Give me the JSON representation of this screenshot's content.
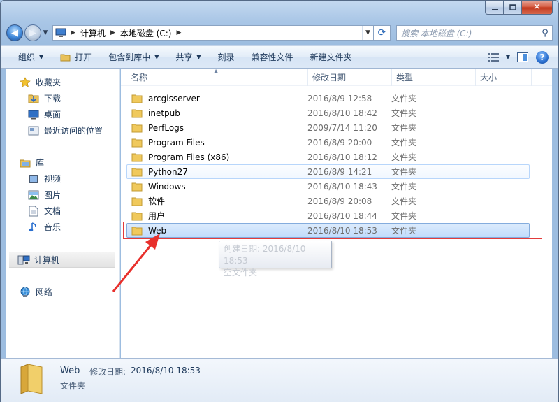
{
  "address": {
    "crumbs": [
      "计算机",
      "本地磁盘 (C:)"
    ]
  },
  "search": {
    "placeholder": "搜索 本地磁盘 (C:)"
  },
  "toolbar": {
    "organize": "组织",
    "open": "打开",
    "include_in_library": "包含到库中",
    "share": "共享",
    "burn": "刻录",
    "compatibility_files": "兼容性文件",
    "new_folder": "新建文件夹"
  },
  "nav": {
    "favorites": {
      "label": "收藏夹",
      "items": [
        "下载",
        "桌面",
        "最近访问的位置"
      ]
    },
    "libraries": {
      "label": "库",
      "items": [
        "视频",
        "图片",
        "文档",
        "音乐"
      ]
    },
    "computer": "计算机",
    "network": "网络"
  },
  "columns": [
    "名称",
    "修改日期",
    "类型",
    "大小"
  ],
  "files": [
    {
      "name": "arcgisserver",
      "date": "2016/8/9 12:58",
      "type": "文件夹"
    },
    {
      "name": "inetpub",
      "date": "2016/8/10 18:42",
      "type": "文件夹"
    },
    {
      "name": "PerfLogs",
      "date": "2009/7/14 11:20",
      "type": "文件夹"
    },
    {
      "name": "Program Files",
      "date": "2016/8/9 20:00",
      "type": "文件夹"
    },
    {
      "name": "Program Files (x86)",
      "date": "2016/8/10 18:12",
      "type": "文件夹"
    },
    {
      "name": "Python27",
      "date": "2016/8/9 14:21",
      "type": "文件夹"
    },
    {
      "name": "Windows",
      "date": "2016/8/10 18:43",
      "type": "文件夹"
    },
    {
      "name": "软件",
      "date": "2016/8/9 20:08",
      "type": "文件夹"
    },
    {
      "name": "用户",
      "date": "2016/8/10 18:44",
      "type": "文件夹"
    },
    {
      "name": "Web",
      "date": "2016/8/10 18:53",
      "type": "文件夹"
    }
  ],
  "tooltip": {
    "line1": "创建日期: 2016/8/10 18:53",
    "line2": "空文件夹"
  },
  "details": {
    "name": "Web",
    "date_label": "修改日期:",
    "date": "2016/8/10 18:53",
    "type": "文件夹"
  },
  "colors": {
    "selection": "#c1dcfc",
    "highlight_box": "#e23b3b",
    "arrow": "#e8302c"
  }
}
